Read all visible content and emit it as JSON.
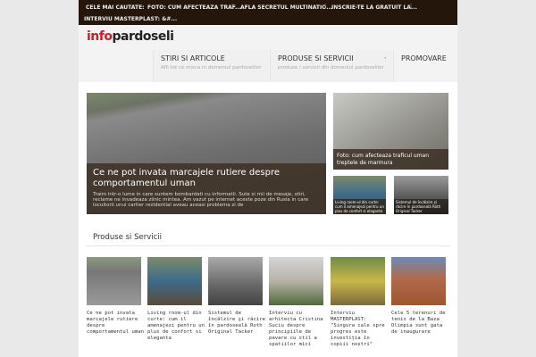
{
  "topbar": {
    "label": "CELE MAI CAUTATE:",
    "links": [
      "FOTO: CUM AFECTEAZA TRAF...",
      "AFLA SECRETUL MULTINATIO...",
      "INSCRIE-TE LA GRATUIT LA...",
      "INTERVIU MASTERPLAST: &#..."
    ]
  },
  "logo": {
    "part1": "info",
    "part2": "pardoseli"
  },
  "nav": [
    {
      "title": "STIRI SI ARTICOLE",
      "sub": "Afli tot ce misca in domeniul pardoselilor"
    },
    {
      "title": "PRODUSE SI SERVICII",
      "sub": "produse / servicii din domeniul pardoselilor"
    },
    {
      "title": "PROMOVARE"
    }
  ],
  "featured": {
    "title": "Ce ne pot invata marcajele rutiere despre comportamentul uman",
    "excerpt": "Traim intr-o lume in care suntem bombardati cu informatii. Sute si mii de mesaje, stiri, reclame ne invadeaza zilnic mintea. Am vazut pe internet aceste poze din Rusia in care locuitorii unui cartier rezidential aveau aceasi problema zi de"
  },
  "side": [
    {
      "title": "Foto: cum afecteaza traficul uman treptele de marmura"
    },
    {
      "title": "Living room-ul din curte: cum il amenajezi pentru un plus de confort si eleganta"
    },
    {
      "title": "Sistemul de încălzire şi răcire în pardoseală Roth Original Tacker"
    }
  ],
  "section_title": "Produse si Servicii",
  "products": [
    {
      "title": "Ce ne pot invata marcajele rutiere despre comportamentul uman"
    },
    {
      "title": "Living room-ul din curte: cum il amenajezi pentru un plus de confort si eleganta"
    },
    {
      "title": "Sistemul de încălzire şi răcire în pardoseală Roth Original Tacker"
    },
    {
      "title": "Interviu cu arhitecta Cristina Suciu despre principiile de pavare cu stil a spatiilor mici"
    },
    {
      "title": "Interviu MASTERPLAST: \"Singura cale spre progres este investiția în copiii noștri\""
    },
    {
      "title": "Cele 5 terenuri de tenis de la Baza Olimpia sunt gata de inaugurare"
    }
  ]
}
